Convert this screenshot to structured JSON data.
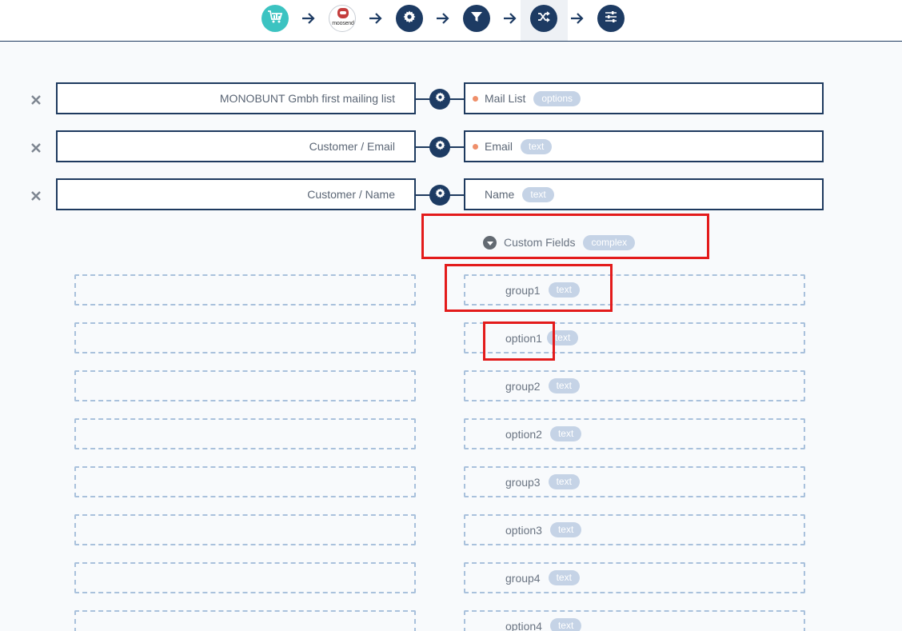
{
  "steps": [
    {
      "name": "analytics-step",
      "icon": "cart-chart-icon"
    },
    {
      "name": "moosend-step",
      "icon": "moosend-logo",
      "logo_text": "moosend"
    },
    {
      "name": "settings-step",
      "icon": "gear-icon"
    },
    {
      "name": "filter-step",
      "icon": "filter-icon"
    },
    {
      "name": "mapping-step",
      "icon": "shuffle-icon",
      "active": true
    },
    {
      "name": "options-step",
      "icon": "sliders-icon"
    }
  ],
  "colors": {
    "primary": "#1d3b63",
    "teal": "#3cc3c1",
    "badge": "#c5d3e6",
    "required_dot": "#ef8f6a",
    "dashed_border": "#a9c1dc",
    "highlight": "#e31b1b"
  },
  "mappings": [
    {
      "source": "MONOBUNT Gmbh first mailing list",
      "target": "Mail List",
      "type": "options",
      "required": true
    },
    {
      "source": "Customer / Email",
      "target": "Email",
      "type": "text",
      "required": true
    },
    {
      "source": "Customer / Name",
      "target": "Name",
      "type": "text",
      "required": false
    }
  ],
  "custom_fields": {
    "label": "Custom Fields",
    "type": "complex",
    "fields": [
      {
        "label": "group1",
        "type": "text"
      },
      {
        "label": "option1",
        "type": "text"
      },
      {
        "label": "group2",
        "type": "text"
      },
      {
        "label": "option2",
        "type": "text"
      },
      {
        "label": "group3",
        "type": "text"
      },
      {
        "label": "option3",
        "type": "text"
      },
      {
        "label": "group4",
        "type": "text"
      },
      {
        "label": "option4",
        "type": "text"
      }
    ]
  }
}
